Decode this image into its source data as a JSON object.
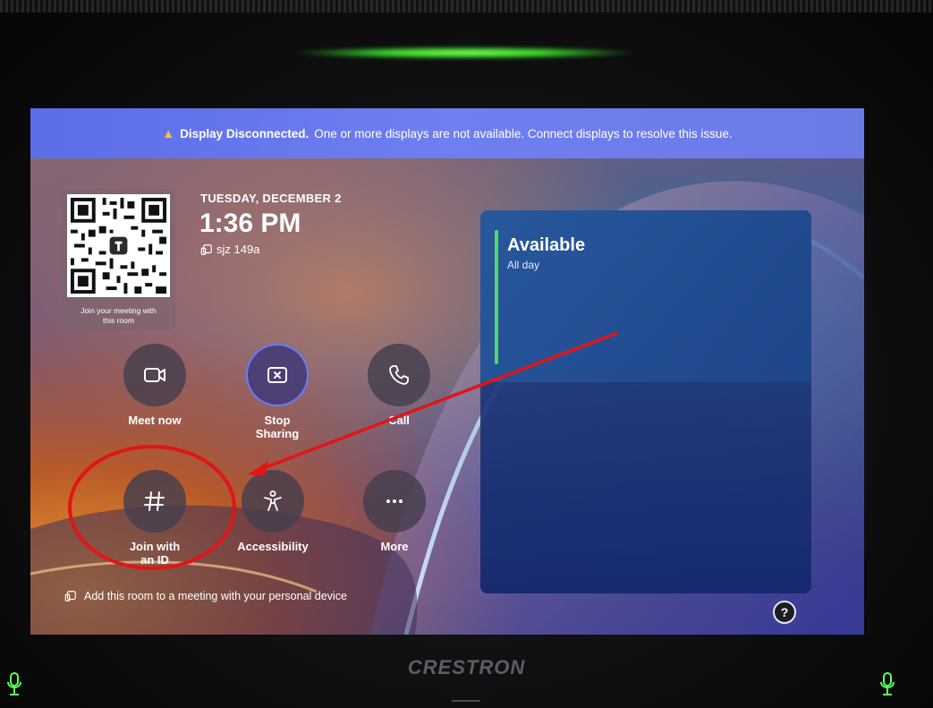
{
  "alert": {
    "icon": "warning-icon",
    "icon_color": "#ffc531",
    "title": "Display Disconnected.",
    "message": "One or more displays are not available. Connect displays to resolve this issue."
  },
  "qr": {
    "caption_line1": "Join your meeting with",
    "caption_line2": "this room"
  },
  "header": {
    "date": "TUESDAY, DECEMBER 2",
    "time": "1:36 PM",
    "room_name": "sjz 149a"
  },
  "actions": {
    "meet_now": {
      "label": "Meet now",
      "icon": "video-camera-icon"
    },
    "stop_sharing": {
      "label_line1": "Stop",
      "label_line2": "Sharing",
      "icon": "stop-share-icon"
    },
    "call": {
      "label": "Call",
      "icon": "phone-icon"
    },
    "join_with_id": {
      "label_line1": "Join with",
      "label_line2": "an ID",
      "icon": "hash-icon"
    },
    "accessibility": {
      "label": "Accessibility",
      "icon": "accessibility-icon"
    },
    "more": {
      "label": "More",
      "icon": "more-dots-icon"
    }
  },
  "calendar": {
    "status": "Available",
    "substatus": "All day",
    "status_color": "#52d86a"
  },
  "footer": {
    "add_room_text": "Add this room to a meeting with your personal device",
    "help_symbol": "?"
  },
  "device": {
    "brand": "CRESTRON"
  },
  "annotation": {
    "color": "#e01616"
  }
}
